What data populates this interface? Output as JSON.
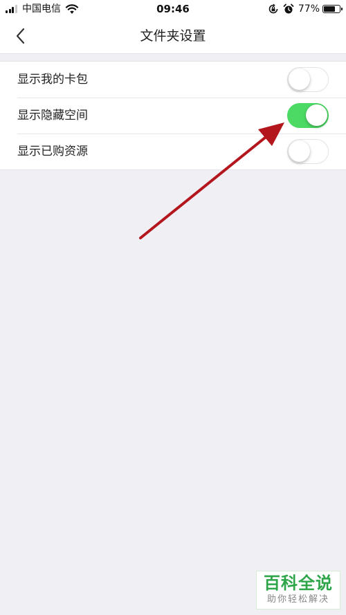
{
  "status_bar": {
    "carrier": "中国电信",
    "time": "09:46",
    "battery_percent": "77%",
    "battery_level": 0.77,
    "icons": [
      "signal-icon",
      "wifi-icon",
      "rotation-lock-icon",
      "alarm-icon",
      "battery-icon"
    ]
  },
  "nav": {
    "back_icon": "chevron-left-icon",
    "title": "文件夹设置"
  },
  "settings": [
    {
      "label": "显示我的卡包",
      "enabled": false
    },
    {
      "label": "显示隐藏空间",
      "enabled": true
    },
    {
      "label": "显示已购资源",
      "enabled": false
    }
  ],
  "colors": {
    "toggle_on": "#4cd964",
    "background": "#efeff4",
    "annotation_arrow": "#b3161c",
    "watermark_green": "#2fa54a"
  },
  "watermark": {
    "title": "百科全说",
    "subtitle": "助你轻松解决"
  }
}
